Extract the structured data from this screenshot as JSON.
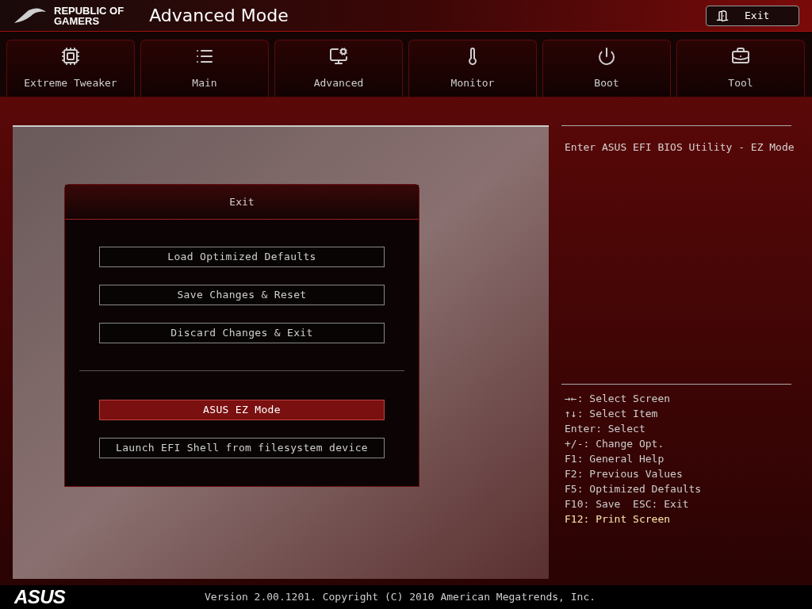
{
  "header": {
    "brand": [
      "REPUBLIC OF",
      "GAMERS"
    ],
    "title": "Advanced Mode",
    "exit_button": "Exit"
  },
  "tabs": [
    {
      "label": "Extreme Tweaker",
      "selected": false
    },
    {
      "label": "Main",
      "selected": false
    },
    {
      "label": "Advanced",
      "selected": false
    },
    {
      "label": "Monitor",
      "selected": false
    },
    {
      "label": "Boot",
      "selected": false
    },
    {
      "label": "Tool",
      "selected": false
    }
  ],
  "dialog": {
    "title": "Exit",
    "groups": [
      [
        {
          "label": "Load Optimized Defaults",
          "selected": false
        },
        {
          "label": "Save Changes & Reset",
          "selected": false
        },
        {
          "label": "Discard Changes & Exit",
          "selected": false
        }
      ],
      [
        {
          "label": "ASUS EZ Mode",
          "selected": true
        },
        {
          "label": "Launch EFI Shell from filesystem device",
          "selected": false
        }
      ]
    ]
  },
  "description": "Enter ASUS EFI BIOS Utility - EZ Mode",
  "help": [
    {
      "text": "→←: Select Screen",
      "highlighted": false
    },
    {
      "text": "↑↓: Select Item",
      "highlighted": false
    },
    {
      "text": "Enter: Select",
      "highlighted": false
    },
    {
      "text": "+/-: Change Opt.",
      "highlighted": false
    },
    {
      "text": "F1: General Help",
      "highlighted": false
    },
    {
      "text": "F2: Previous Values",
      "highlighted": false
    },
    {
      "text": "F5: Optimized Defaults",
      "highlighted": false
    },
    {
      "text": "F10: Save  ESC: Exit",
      "highlighted": false
    },
    {
      "text": "F12: Print Screen",
      "highlighted": true
    }
  ],
  "footer": {
    "logo": "ASUS",
    "version": "Version 2.00.1201. Copyright (C) 2010 American Megatrends, Inc."
  }
}
